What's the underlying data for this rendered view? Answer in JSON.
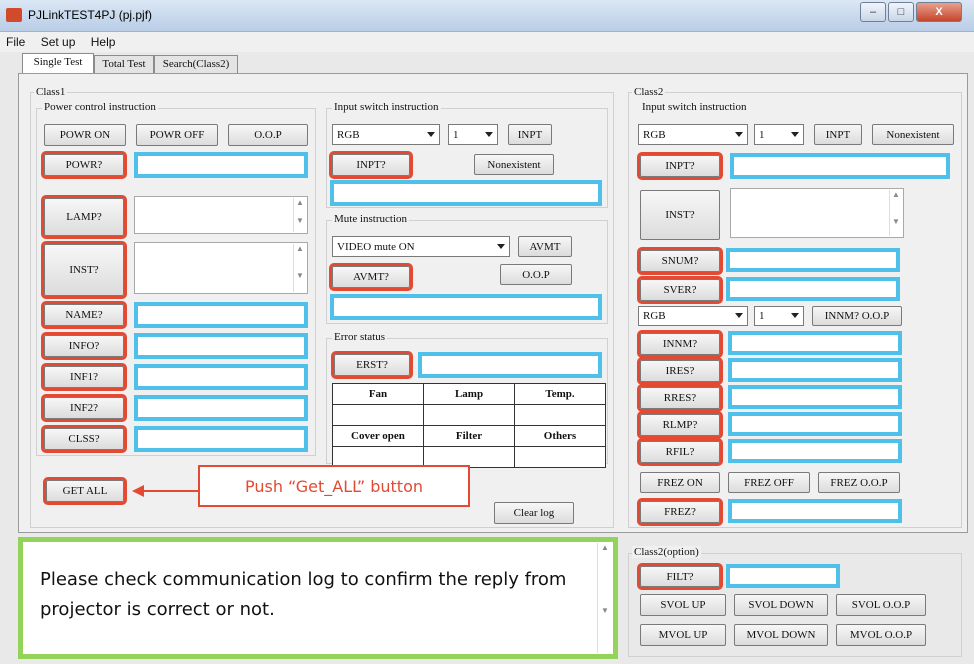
{
  "window": {
    "title": "PJLinkTEST4PJ (pj.pjf)",
    "minimize": "–",
    "maximize": "□",
    "close": "X"
  },
  "menu": {
    "file": "File",
    "setup": "Set up",
    "help": "Help"
  },
  "tabs": {
    "single": "Single Test",
    "total": "Total Test",
    "search": "Search(Class2)"
  },
  "class1": {
    "label": "Class1",
    "power": {
      "label": "Power control instruction",
      "on": "POWR ON",
      "off": "POWR OFF",
      "oop": "O.O.P"
    },
    "query": {
      "powr": "POWR?",
      "lamp": "LAMP?",
      "inst": "INST?",
      "name": "NAME?",
      "info": "INFO?",
      "inf1": "INF1?",
      "inf2": "INF2?",
      "clss": "CLSS?"
    },
    "input": {
      "label": "Input switch instruction",
      "source": "RGB",
      "number": "1",
      "inpt": "INPT",
      "inpt_q": "INPT?",
      "nonexistent": "Nonexistent"
    },
    "mute": {
      "label": "Mute instruction",
      "mode": "VIDEO mute ON",
      "avmt": "AVMT",
      "avmt_q": "AVMT?",
      "oop": "O.O.P"
    },
    "error": {
      "label": "Error status",
      "erst_q": "ERST?",
      "headers1": [
        "Fan",
        "Lamp",
        "Temp."
      ],
      "headers2": [
        "Cover open",
        "Filter",
        "Others"
      ]
    },
    "get_all": "GET ALL",
    "clear_log": "Clear log"
  },
  "class2": {
    "label": "Class2",
    "input": {
      "label": "Input switch instruction",
      "source": "RGB",
      "number": "1",
      "inpt": "INPT",
      "nonexistent": "Nonexistent",
      "inpt_q": "INPT?"
    },
    "inst_q": "INST?",
    "snum": "SNUM?",
    "sver": "SVER?",
    "innm": {
      "source": "RGB",
      "number": "1",
      "oop": "INNM? O.O.P",
      "q": "INNM?"
    },
    "ires": "IRES?",
    "rres": "RRES?",
    "rlmp": "RLMP?",
    "rfil": "RFIL?",
    "frez": {
      "on": "FREZ ON",
      "off": "FREZ OFF",
      "oop": "FREZ O.O.P",
      "q": "FREZ?"
    }
  },
  "class2opt": {
    "label": "Class2(option)",
    "filt": "FILT?",
    "svol_up": "SVOL UP",
    "svol_down": "SVOL DOWN",
    "svol_oop": "SVOL O.O.P",
    "mvol_up": "MVOL UP",
    "mvol_down": "MVOL DOWN",
    "mvol_oop": "MVOL O.O.P"
  },
  "annotations": {
    "callout": "Push “Get_ALL” button",
    "log_note": "Please check communication log to confirm the reply from projector is correct or not."
  },
  "colors": {
    "highlight_red": "#e24a33",
    "highlight_blue": "#4fc0ea",
    "highlight_green": "#93d35a"
  }
}
